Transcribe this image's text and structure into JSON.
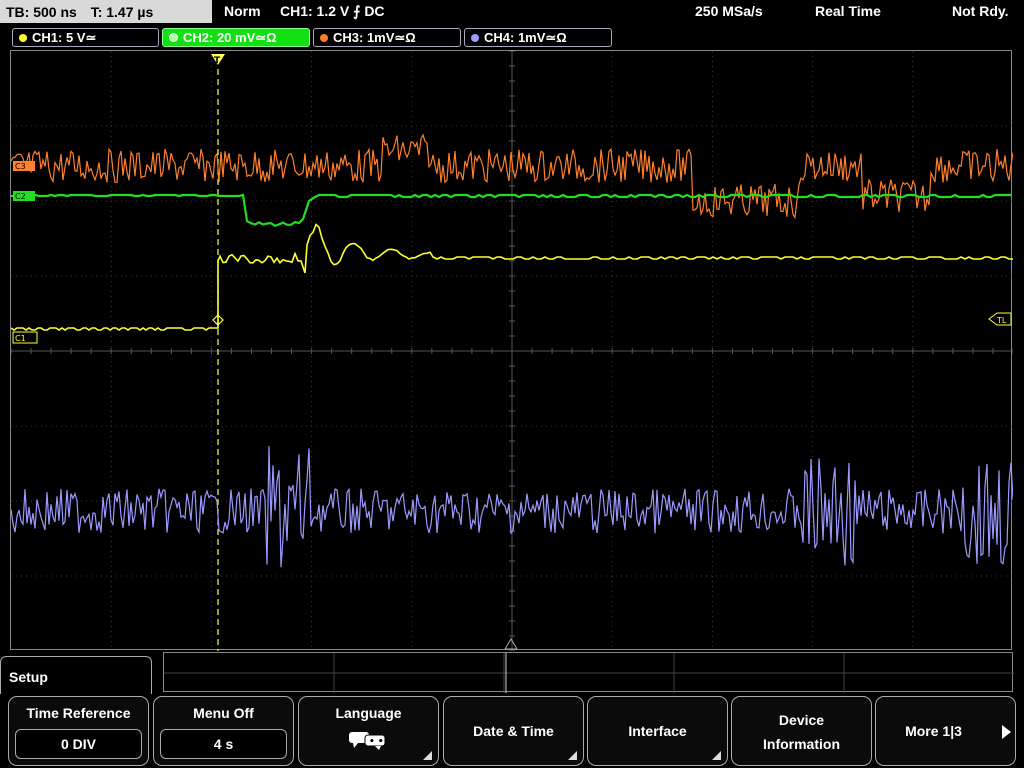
{
  "status": {
    "tb": "TB: 500 ns",
    "t": "T: 1.47 µs",
    "mode": "Norm",
    "trigger": "CH1: 1.2 V ⨍ DC",
    "sample_rate": "250 MSa/s",
    "acq": "Real Time",
    "ready": "Not Rdy."
  },
  "channels": [
    {
      "label": "CH1: 5 V≃",
      "color": "#ffff33"
    },
    {
      "label": "CH2: 20 mV≃Ω",
      "color": "#22dd22"
    },
    {
      "label": "CH3: 1mV≃Ω",
      "color": "#ff7f2a"
    },
    {
      "label": "CH4: 1mV≃Ω",
      "color": "#9999ff"
    }
  ],
  "markers": {
    "c1": "C1",
    "c2": "C2",
    "c3": "C3",
    "tl": "TL",
    "trigger": "T"
  },
  "menu": {
    "tab": "Setup",
    "buttons": [
      {
        "label": "Time Reference",
        "value": "0 DIV"
      },
      {
        "label": "Menu Off",
        "value": "4 s"
      },
      {
        "label": "Language"
      },
      {
        "label": "Date & Time"
      },
      {
        "label": "Interface"
      },
      {
        "label": "Device",
        "label2": "Information"
      },
      {
        "label": "More 1|3"
      }
    ]
  }
}
